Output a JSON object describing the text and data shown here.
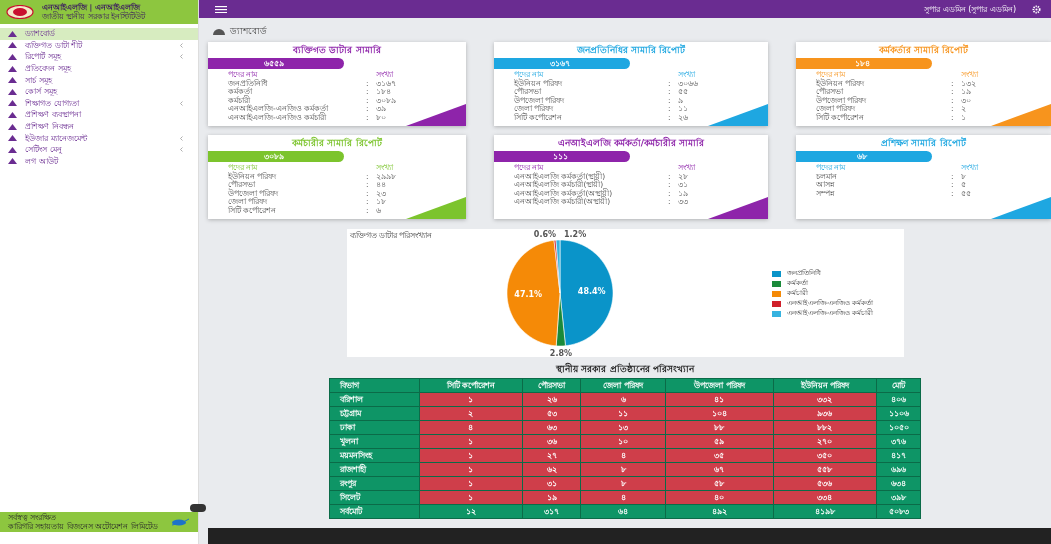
{
  "brand": {
    "title": "এনআইএলজি | এনআইএলজি",
    "subtitle": "জাতীয় স্থানীয় সরকার ইনস্টিটিউট"
  },
  "sidebar": {
    "items": [
      {
        "label": "ড্যাশবোর্ড",
        "selected": true,
        "has_submenu": false
      },
      {
        "label": "ব্যক্তিগত ডাটা শীট",
        "selected": false,
        "has_submenu": true
      },
      {
        "label": "রিপোর্ট সমূহ",
        "selected": false,
        "has_submenu": true
      },
      {
        "label": "প্রতিবেদন সমূহ",
        "selected": false,
        "has_submenu": false
      },
      {
        "label": "সার্চ সমূহ",
        "selected": false,
        "has_submenu": false
      },
      {
        "label": "কোর্স সমূহ",
        "selected": false,
        "has_submenu": false
      },
      {
        "label": "শিক্ষাগত যোগ্যতা",
        "selected": false,
        "has_submenu": true
      },
      {
        "label": "প্রশিক্ষণ ব্যবস্থাপনা",
        "selected": false,
        "has_submenu": false
      },
      {
        "label": "প্রশিক্ষণ নিবন্ধন",
        "selected": false,
        "has_submenu": false
      },
      {
        "label": "ইউজার ম্যানেজমেন্ট",
        "selected": false,
        "has_submenu": true
      },
      {
        "label": "সেটিংস মেনু",
        "selected": false,
        "has_submenu": true
      },
      {
        "label": "লগ আউট",
        "selected": false,
        "has_submenu": false
      }
    ],
    "footer": {
      "line_1": "সর্বস্বত্ব সংরক্ষিত",
      "line_2": "কারিগরি সহায়তায় বিজনেস অটোমেশন লিমিটেড"
    }
  },
  "topbar": {
    "user": "সুপার এডমিন (সুপার এডমিন)"
  },
  "page_title": "ড্যাশবোর্ড",
  "card_separator": ":",
  "cards": [
    {
      "title": "ব্যক্তিগত ডাটার সামারি",
      "total": "৬৫৫৯",
      "color": "#8e24aa",
      "header": [
        "পদের নাম",
        "সংখ্যা"
      ],
      "rows": [
        [
          "জনপ্রতিনিধি",
          "৩১৬৭"
        ],
        [
          "কর্মকর্তা",
          "১৮৪"
        ],
        [
          "কর্মচারী",
          "৩০৮৯"
        ],
        [
          "এনআইএলজি-এনজিও কর্মকর্তা",
          "৩৯"
        ],
        [
          "এনআইএলজি-এনজিও কর্মচারী",
          "৮০"
        ]
      ]
    },
    {
      "title": "জনপ্রতিনিধির সামারি রিপোর্ট",
      "total": "৩১৬৭",
      "color": "#1ea7e1",
      "header": [
        "পদের নাম",
        "সংখ্যা"
      ],
      "rows": [
        [
          "ইউনিয়ন পরিষদ",
          "৩০৬৬"
        ],
        [
          "পৌরসভা",
          "৫৫"
        ],
        [
          "উপজেলা পরিষদ",
          "৯"
        ],
        [
          "জেলা পরিষদ",
          "১১"
        ],
        [
          "সিটি কর্পোরেশন",
          "২৬"
        ]
      ]
    },
    {
      "title": "কর্মকর্তার সামারি রিপোর্ট",
      "total": "১৮৪",
      "color": "#f7941d",
      "header": [
        "পদের নাম",
        "সংখ্যা"
      ],
      "rows": [
        [
          "ইউনিয়ন পরিষদ",
          "১৩২"
        ],
        [
          "পৌরসভা",
          "১৯"
        ],
        [
          "উপজেলা পরিষদ",
          "৩০"
        ],
        [
          "জেলা পরিষদ",
          "২"
        ],
        [
          "সিটি কর্পোরেশন",
          "১"
        ]
      ]
    },
    {
      "title": "কর্মচারীর সামারি রিপোর্ট",
      "total": "৩০৮৯",
      "color": "#7cc42d",
      "header": [
        "পদের নাম",
        "সংখ্যা"
      ],
      "rows": [
        [
          "ইউনিয়ন পরিষদ",
          "২৯৯৮"
        ],
        [
          "পৌরসভা",
          "৪৪"
        ],
        [
          "উপজেলা পরিষদ",
          "২৩"
        ],
        [
          "জেলা পরিষদ",
          "১৮"
        ],
        [
          "সিটি কর্পোরেশন",
          "৬"
        ]
      ]
    },
    {
      "title": "এনআইএলজি কর্মকর্তা/কর্মচারীর সামারি",
      "total": "১১১",
      "color": "#8e24aa",
      "header": [
        "পদের নাম",
        "সংখ্যা"
      ],
      "rows": [
        [
          "এনআইএলজি কর্মকর্তা(স্থায়ী)",
          "২৮"
        ],
        [
          "এনআইএলজি কর্মচারী(স্থায়ী)",
          "৩১"
        ],
        [
          "এনআইএলজি কর্মকর্তা(অস্থায়ী)",
          "১৯"
        ],
        [
          "এনআইএলজি কর্মচারী(অস্থায়ী)",
          "৩৩"
        ]
      ]
    },
    {
      "title": "প্রশিক্ষণ সামারি রিপোর্ট",
      "total": "৬৮",
      "color": "#1ea7e1",
      "header": [
        "পদের নাম",
        "সংখ্যা"
      ],
      "rows": [
        [
          "চলমান",
          "৮"
        ],
        [
          "আসন্ন",
          "৫"
        ],
        [
          "সম্পন্ন",
          "৫৫"
        ]
      ]
    }
  ],
  "pie": {
    "chart_data": {
      "type": "pie",
      "title": "ব্যক্তিগত ডাটার পরিসংখ্যান",
      "categories": [
        "জনপ্রতিনিধি",
        "কর্মকর্তা",
        "কর্মচারী",
        "এনআইএলজি-এনজিও কর্মকর্তা",
        "এনআইএলজি-এনজিও কর্মচারী"
      ],
      "values": [
        48.4,
        2.8,
        47.1,
        0.6,
        1.2
      ],
      "colors": [
        "#0a94c9",
        "#1a8a3a",
        "#f58a07",
        "#d0202a",
        "#36b3e0"
      ],
      "value_labels": [
        "48.4%",
        "2.8%",
        "47.1%",
        "0.6%",
        "1.2%"
      ],
      "legend": "right"
    }
  },
  "stats_table": {
    "title": "স্থানীয় সরকার প্রতিষ্ঠানের পরিসংখ্যান",
    "columns": [
      "বিভাগ",
      "সিটি কর্পোরেশন",
      "পৌরসভা",
      "জেলা পরিষদ",
      "উপজেলা পরিষদ",
      "ইউনিয়ন পরিষদ",
      "মোট"
    ],
    "rows": [
      [
        "বরিশাল",
        "১",
        "২৬",
        "৬",
        "৪১",
        "৩৩২",
        "৪০৬"
      ],
      [
        "চট্টগ্রাম",
        "২",
        "৫৩",
        "১১",
        "১০৪",
        "৯৩৬",
        "১১০৬"
      ],
      [
        "ঢাকা",
        "৪",
        "৬৩",
        "১৩",
        "৮৮",
        "৮৮২",
        "১০৫০"
      ],
      [
        "খুলনা",
        "১",
        "৩৬",
        "১০",
        "৫৯",
        "২৭০",
        "৩৭৬"
      ],
      [
        "ময়মনসিংহ",
        "১",
        "২৭",
        "৪",
        "৩৫",
        "৩৫০",
        "৪১৭"
      ],
      [
        "রাজশাহী",
        "১",
        "৬২",
        "৮",
        "৬৭",
        "৫৫৮",
        "৬৯৬"
      ],
      [
        "রংপুর",
        "১",
        "৩১",
        "৮",
        "৫৮",
        "৫৩৬",
        "৬৩৪"
      ],
      [
        "সিলেট",
        "১",
        "১৯",
        "৪",
        "৪০",
        "৩৩৪",
        "৩৯৮"
      ]
    ],
    "total_row": [
      "সর্বমোট",
      "১২",
      "৩১৭",
      "৬৪",
      "৪৯২",
      "৪১৯৮",
      "৫০৮৩"
    ]
  }
}
